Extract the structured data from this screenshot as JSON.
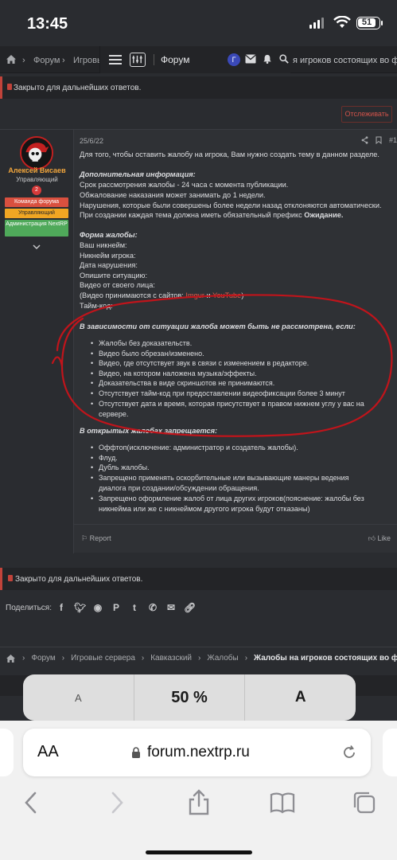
{
  "status": {
    "time": "13:45",
    "battery": "51"
  },
  "nav": {
    "crumb1": "Форум",
    "crumb2": "Игровь",
    "crumb_tail": "я игроков состоящих во фрак",
    "forum_label": "Форум",
    "avatar_letter": "Г"
  },
  "notice_top": "Закрыто для дальнейших ответов.",
  "watch_button": "Отслеживать",
  "user": {
    "name": "Алексей Висаев",
    "role": "Управляющий",
    "badge_num": "2",
    "banners": [
      "Команда форума",
      "Управляющий",
      "Администрация NextRP"
    ]
  },
  "post": {
    "date": "25/6/22",
    "number": "#1",
    "intro": "Для того, чтобы оставить жалобу на игрока, Вам нужно создать тему в данном разделе.",
    "info_title": "Дополнительная информация:",
    "info_lines": [
      "Срок рассмотрения жалобы - 24 часа с момента публикации.",
      "Обжалование наказания может занимать до 1 недели.",
      "Нарушения, которые были совершены более недели назад отклоняются автоматически."
    ],
    "prefix_line": "При создании каждая тема должна иметь обязательный префикс ",
    "prefix_bold": "Ожидание.",
    "form_title": "Форма жалобы:",
    "form_lines": [
      "Ваш никнейм:",
      "Никнейм игрока:",
      "Дата нарушения:",
      "Опишите ситуацию:",
      "Видео от своего лица:"
    ],
    "video_prefix": "(Видео принимаются с сайтов: ",
    "imgur": "Imgur",
    "video_and": " и ",
    "youtube": "YouTube",
    "video_suffix": ")",
    "timecode": "Тайм-код:",
    "reject_title": "В зависимости от ситуации жалоба может быть не рассмотрена, если:",
    "reject_items": [
      "Жалобы без доказательств.",
      "Видео было обрезан/изменено.",
      "Видео, где отсутствует звук в связи с изменением в редакторе.",
      "Видео, на котором наложена музыка/эффекты.",
      "Доказательства в виде скриншотов не принимаются.",
      "Отсутствует тайм-код при предоставлении видеофиксации более 3 минут",
      "Отсутствует дата и время, которая присутствует в правом нижнем углу у вас на",
      "сервере."
    ],
    "forbidden_title": "В открытых жалобах запрещается:",
    "forbidden_items": [
      "Оффтоп(исключение: администратор и создатель жалобы).",
      "Флуд.",
      "Дубль жалобы.",
      "Запрещено применять оскорбительные или вызывающие манеры ведения",
      "диалога при создании/обсуждении обращения.",
      "Запрещено оформление жалоб от лица других игроков(пояснение: жалобы без",
      "никнейма или же с никнеймом другого игрока будут отказаны)"
    ],
    "report": "Report",
    "like": "Like"
  },
  "notice_bottom": "Закрыто для дальнейших ответов.",
  "share_label": "Поделиться:",
  "breadcrumb_bottom": [
    "Форум",
    "Игровые сервера",
    "Кавказский",
    "Жалобы",
    "Жалобы на игроков состоящих во фрак"
  ],
  "zoom": {
    "small": "A",
    "percent": "50 %",
    "large": "A"
  },
  "safari": {
    "aa": "AA",
    "url": "forum.nextrp.ru"
  },
  "colors": {
    "accent": "#e55a4a",
    "username": "#f2a63c",
    "scribble": "#c0141b"
  },
  "icons": [
    "home-icon",
    "menu-icon",
    "filter-icon",
    "mail-icon",
    "bell-icon",
    "search-icon",
    "lock-icon",
    "share-icon",
    "bookmark-icon",
    "facebook-icon",
    "twitter-icon",
    "reddit-icon",
    "pinterest-icon",
    "tumblr-icon",
    "whatsapp-icon",
    "email-icon",
    "link-icon",
    "back-icon",
    "forward-icon",
    "book-icon",
    "tabs-icon",
    "reload-icon",
    "padlock-icon"
  ]
}
